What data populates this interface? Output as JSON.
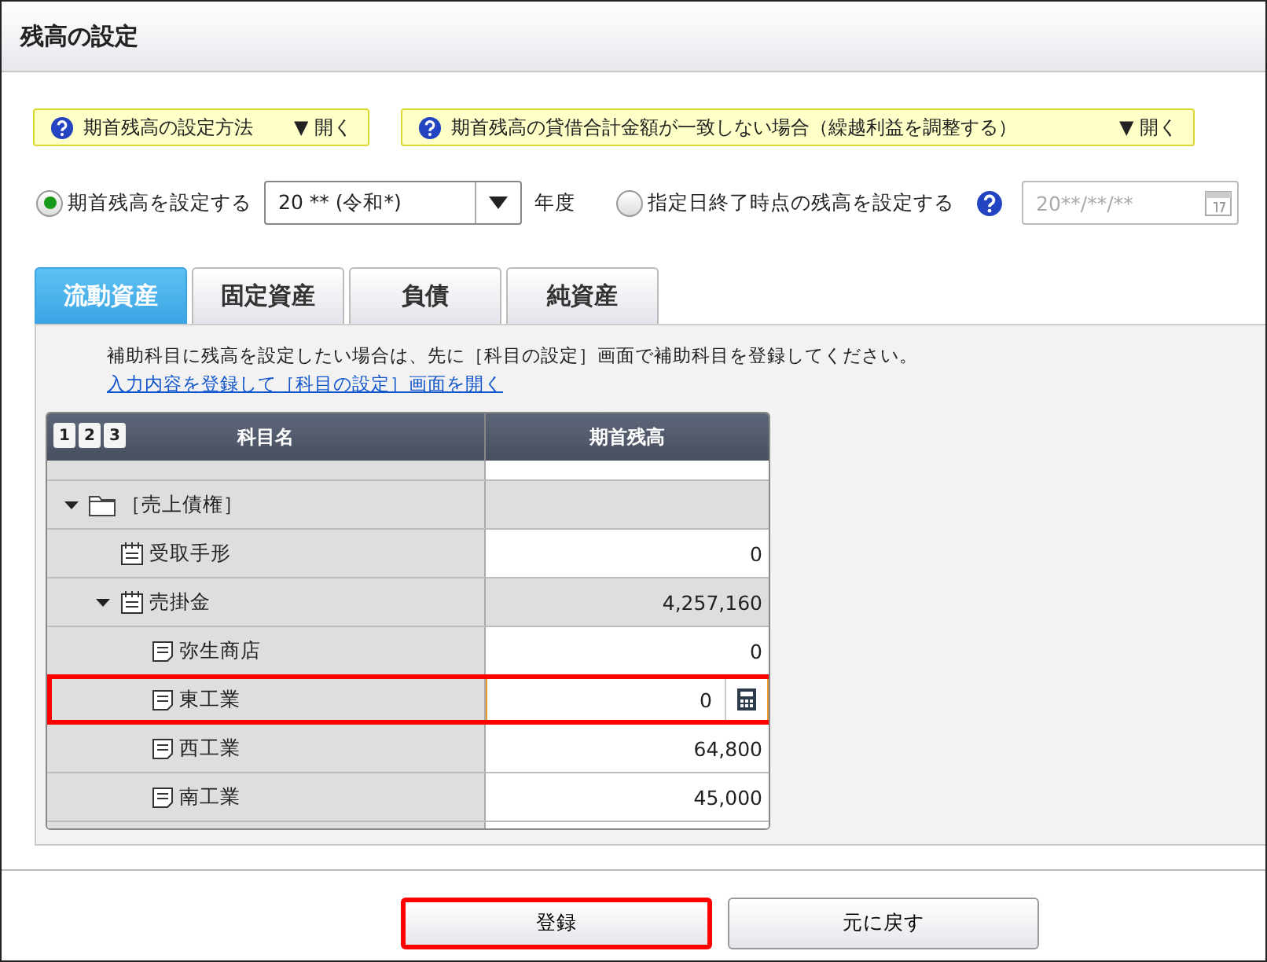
{
  "window": {
    "title": "残高の設定"
  },
  "help_bars": [
    {
      "label": "期首残高の設定方法",
      "toggle": "▼ 開く"
    },
    {
      "label": "期首残高の貸借合計金額が一致しない場合（繰越利益を調整する）",
      "toggle": "▼ 開く"
    }
  ],
  "options": [
    {
      "kind": "year",
      "label": "期首残高を設定する",
      "selected": true,
      "value": "20 ** (令和*)",
      "suffix": "年度"
    },
    {
      "kind": "date",
      "label": "指定日終了時点の残高を設定する",
      "selected": false,
      "placeholder": "20**/**/**"
    }
  ],
  "tabs": [
    {
      "label": "流動資産",
      "selected": true
    },
    {
      "label": "固定資産",
      "selected": false
    },
    {
      "label": "負債",
      "selected": false
    },
    {
      "label": "純資産",
      "selected": false
    }
  ],
  "note": "補助科目に残高を設定したい場合は、先に［科目の設定］画面で補助科目を登録してください。",
  "link": "入力内容を登録して［科目の設定］画面を開く",
  "table": {
    "levels": [
      "1",
      "2",
      "3"
    ],
    "columns": [
      "科目名",
      "期首残高"
    ],
    "rows": [
      {
        "kind": "folder",
        "label": "［売上債権］",
        "expanded": true,
        "children": [
          {
            "kind": "account",
            "label": "受取手形",
            "value": "0"
          },
          {
            "kind": "account",
            "label": "売掛金",
            "value": "4,257,160",
            "expanded": true,
            "children": [
              {
                "kind": "sub",
                "label": "弥生商店",
                "value": "0"
              },
              {
                "kind": "sub",
                "label": "東工業",
                "value": "0",
                "editing": true,
                "highlighted": true
              },
              {
                "kind": "sub",
                "label": "西工業",
                "value": "64,800"
              },
              {
                "kind": "sub",
                "label": "南工業",
                "value": "45,000"
              }
            ]
          }
        ]
      }
    ]
  },
  "buttons": [
    {
      "label": "登録",
      "highlighted": true
    },
    {
      "label": "元に戻す",
      "highlighted": false
    }
  ]
}
